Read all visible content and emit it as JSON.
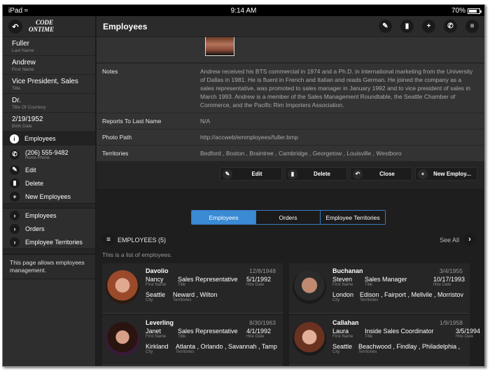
{
  "status_bar": {
    "device": "iPad",
    "time": "9:14 AM",
    "battery": "70%",
    "battery_level": 0.7
  },
  "logo": {
    "line1": "CODE",
    "line2": "ONTIME"
  },
  "sidebar": {
    "fields": [
      {
        "value": "Fuller",
        "label": "Last Name"
      },
      {
        "value": "Andrew",
        "label": "First Name"
      },
      {
        "value": "Vice President, Sales",
        "label": "Title"
      },
      {
        "value": "Dr.",
        "label": "Title Of Courtesy"
      },
      {
        "value": "2/19/1952",
        "label": "Birth Date"
      }
    ],
    "section_label": "Employees",
    "phone": {
      "value": "(206) 555-9482",
      "label": "Home Phone"
    },
    "actions": [
      "Edit",
      "Delete",
      "New Employees"
    ],
    "links": [
      "Employees",
      "Orders",
      "Employee Territories"
    ],
    "note": "This page allows employees management."
  },
  "header": {
    "title": "Employees"
  },
  "details": {
    "notes_label": "Notes",
    "notes": "Andrew received his BTS commercial in 1974 and a Ph.D. in international marketing from the University of Dallas in 1981. He is fluent in French and Italian and reads German. He joined the company as a sales representative, was promoted to sales manager in January 1992 and to vice president of sales in March 1993. Andrew is a member of the Sales Management Roundtable, the Seattle Chamber of Commerce, and the Pacific Rim Importers Association.",
    "rows": [
      {
        "label": "Reports To Last Name",
        "value": "N/A"
      },
      {
        "label": "Photo Path",
        "value": "http://accweb/emmployees/fuller.bmp"
      },
      {
        "label": "Territories",
        "value": "Bedford , Boston , Braintree , Cambridge , Georgetow , Louisville , Westboro"
      }
    ]
  },
  "action_buttons": [
    "Edit",
    "Delete",
    "Close",
    "New Employ..."
  ],
  "tabs": [
    {
      "label": "Employees",
      "active": true
    },
    {
      "label": "Orders",
      "active": false
    },
    {
      "label": "Employee Territories",
      "active": false
    }
  ],
  "list": {
    "title": "EMPLOYEES (5)",
    "see_all": "See All",
    "description": "This is a list of employees.",
    "field_labels": {
      "first": "First Name",
      "title": "Title",
      "hire": "Hire Date",
      "city": "City",
      "territories": "Territories"
    },
    "cards": [
      {
        "last": "Davolio",
        "birth": "12/8/1948",
        "first": "Nancy",
        "title": "Sales Representative",
        "hire": "5/1/1992",
        "city": "Seattle",
        "territories": "Neward , Wilton"
      },
      {
        "last": "Buchanan",
        "birth": "3/4/1955",
        "first": "Steven",
        "title": "Sales Manager",
        "hire": "10/17/1993",
        "city": "London",
        "territories": "Edison , Fairport , Mellvile , Morristov"
      },
      {
        "last": "Leverling",
        "birth": "8/30/1963",
        "first": "Janet",
        "title": "Sales Representative",
        "hire": "4/1/1992",
        "city": "Kirkland",
        "territories": "Atlanta , Orlando , Savannah , Tamp"
      },
      {
        "last": "Callahan",
        "birth": "1/9/1958",
        "first": "Laura",
        "title": "Inside Sales Coordinator",
        "hire": "3/5/1994",
        "city": "Seattle",
        "territories": "Beachwood , Findlay , Philadelphia ,"
      }
    ]
  },
  "colors": {
    "accent": "#3a8ad4",
    "background": "#1e1e1e",
    "panel": "#333333"
  }
}
